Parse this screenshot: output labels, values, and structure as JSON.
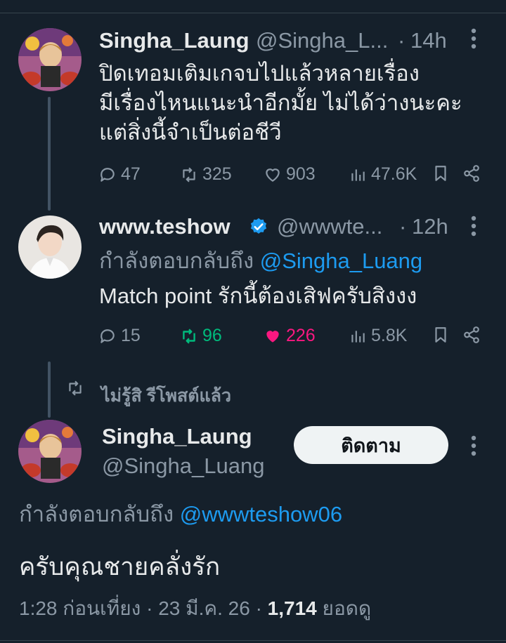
{
  "tweet1": {
    "name": "Singha_Laung",
    "handle": "@Singha_L...",
    "dot": "·",
    "time": "14h",
    "lines": [
      "ปิดเทอมเติมเกจบไปแล้วหลายเรื่อง",
      "มีเรื่องไหนแนะนำอีกมั้ย ไม่ได้ว่างนะคะ",
      "แต่สิ่งนี้จำเป็นต่อชีวี"
    ],
    "replies": "47",
    "retweets": "325",
    "likes": "903",
    "views": "47.6K"
  },
  "tweet2": {
    "name": "www.teshow",
    "handle": "@wwwte...",
    "dot": "·",
    "time": "12h",
    "replying_prefix": "กำลังตอบกลับถึง",
    "replying_to": "@Singha_Luang",
    "text": "Match point รักนี้ต้องเสิฟครับสิงงง",
    "replies": "15",
    "retweets": "96",
    "likes": "226",
    "views": "5.8K",
    "colors": {
      "retweet": "#00ba7c",
      "like": "#f91880",
      "verified": "#1d9bf0"
    }
  },
  "repost_notice": "ไม่รู้สิ รีโพสต์แล้ว",
  "main_tweet": {
    "name": "Singha_Laung",
    "handle": "@Singha_Luang",
    "follow_label": "ติดตาม",
    "replying_prefix": "กำลังตอบกลับถึง",
    "replying_to": "@wwwteshow06",
    "text": "ครับคุณชายคลั่งรัก",
    "time": "1:28 ก่อนเที่ยง",
    "sep1": "·",
    "date": "23 มี.ค. 26",
    "sep2": "·",
    "views_count": "1,714",
    "views_label": "ยอดดู"
  },
  "icons": [
    "reply-icon",
    "retweet-icon",
    "like-icon",
    "views-icon",
    "bookmark-icon",
    "share-icon",
    "more-icon",
    "verified-icon"
  ]
}
